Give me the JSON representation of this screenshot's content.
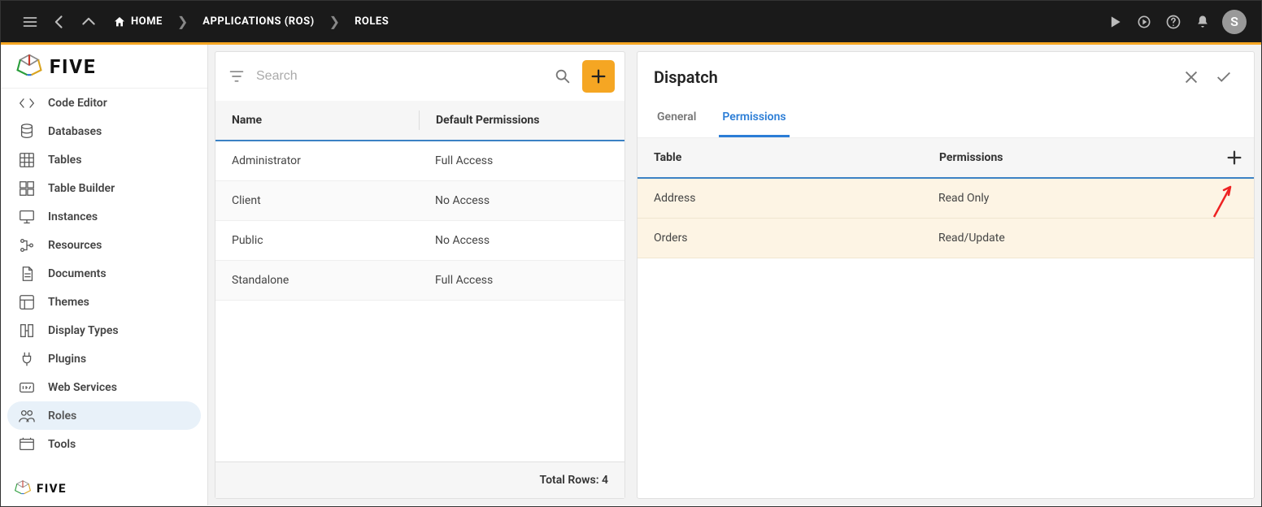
{
  "topbar": {
    "home_label": "HOME",
    "crumbs": [
      "APPLICATIONS (ROS)",
      "ROLES"
    ],
    "avatar_letter": "S"
  },
  "brand": {
    "name": "FIVE"
  },
  "sidebar": {
    "items": [
      {
        "label": "Code Editor",
        "icon": "code-icon"
      },
      {
        "label": "Databases",
        "icon": "database-icon"
      },
      {
        "label": "Tables",
        "icon": "grid-icon"
      },
      {
        "label": "Table Builder",
        "icon": "builder-icon"
      },
      {
        "label": "Instances",
        "icon": "monitor-icon"
      },
      {
        "label": "Resources",
        "icon": "tree-icon"
      },
      {
        "label": "Documents",
        "icon": "document-icon"
      },
      {
        "label": "Themes",
        "icon": "theme-icon"
      },
      {
        "label": "Display Types",
        "icon": "display-icon"
      },
      {
        "label": "Plugins",
        "icon": "plug-icon"
      },
      {
        "label": "Web Services",
        "icon": "api-icon"
      },
      {
        "label": "Roles",
        "icon": "roles-icon",
        "selected": true
      },
      {
        "label": "Tools",
        "icon": "tools-icon"
      }
    ]
  },
  "roles_panel": {
    "search_placeholder": "Search",
    "columns": [
      "Name",
      "Default Permissions"
    ],
    "rows": [
      {
        "name": "Administrator",
        "perm": "Full Access"
      },
      {
        "name": "Client",
        "perm": "No Access"
      },
      {
        "name": "Public",
        "perm": "No Access"
      },
      {
        "name": "Standalone",
        "perm": "Full Access"
      }
    ],
    "footer": "Total Rows: 4"
  },
  "detail_panel": {
    "title": "Dispatch",
    "tabs": [
      "General",
      "Permissions"
    ],
    "active_tab": 1,
    "columns": [
      "Table",
      "Permissions"
    ],
    "rows": [
      {
        "table": "Address",
        "perm": "Read Only"
      },
      {
        "table": "Orders",
        "perm": "Read/Update"
      }
    ]
  }
}
